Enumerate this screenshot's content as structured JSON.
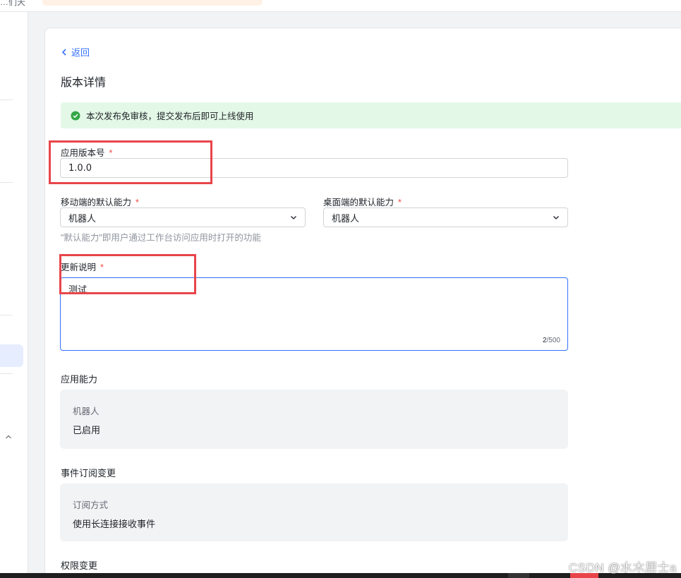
{
  "topbar": {
    "fragment": "…们天"
  },
  "back": {
    "label": "返回"
  },
  "page": {
    "title": "版本详情"
  },
  "notice": {
    "text": "本次发布免审核，提交发布后即可上线使用",
    "color": "#e4f8e7"
  },
  "form": {
    "version": {
      "label": "应用版本号",
      "required": "*",
      "value": "1.0.0"
    },
    "mobile_default": {
      "label": "移动端的默认能力",
      "required": "*",
      "value": "机器人"
    },
    "desktop_default": {
      "label": "桌面端的默认能力",
      "required": "*",
      "value": "机器人"
    },
    "default_hint": "\"默认能力\"即用户通过工作台访问应用时打开的功能",
    "update_notes": {
      "label": "更新说明",
      "required": "*",
      "value": "测试",
      "count": "2",
      "max": "/500"
    }
  },
  "capabilities": {
    "title": "应用能力",
    "key": "机器人",
    "value": "已启用"
  },
  "events": {
    "title": "事件订阅变更",
    "key": "订阅方式",
    "value": "使用长连接接收事件"
  },
  "permissions": {
    "title": "权限变更"
  },
  "watermark": "CSDN @水木居士a",
  "colors": {
    "accent": "#3370ff",
    "required": "#f54a45",
    "highlight": "#e8454a"
  }
}
